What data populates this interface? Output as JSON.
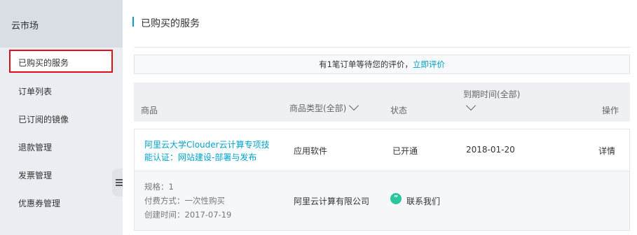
{
  "sidebar": {
    "title": "云市场",
    "items": [
      {
        "label": "已购买的服务",
        "active": true
      },
      {
        "label": "订单列表"
      },
      {
        "label": "已订阅的镜像"
      },
      {
        "label": "退款管理"
      },
      {
        "label": "发票管理"
      },
      {
        "label": "优惠券管理"
      }
    ]
  },
  "page": {
    "title": "已购买的服务"
  },
  "notice": {
    "text": "有1笔订单等待您的评价，",
    "link": "立即评价"
  },
  "table": {
    "headers": {
      "product": "商品",
      "product_type": "商品类型(全部)",
      "status": "状态",
      "expiry": "到期时间(全部)",
      "actions": "操作"
    },
    "row": {
      "product_name": "阿里云大学Clouder云计算专项技能认证：网站建设-部署与发布",
      "product_type": "应用软件",
      "status": "已开通",
      "expiry_date": "2018-01-20",
      "detail_link": "详情",
      "spec": "规格：1",
      "payment": "付费方式：一次性购买",
      "created": "创建时间：2017-07-19",
      "vendor": "阿里云计算有限公司",
      "contact": "联系我们"
    }
  },
  "colors": {
    "accent": "#00a2ca",
    "highlight_border": "#e0101a",
    "contact_icon": "#2bc5a0"
  }
}
